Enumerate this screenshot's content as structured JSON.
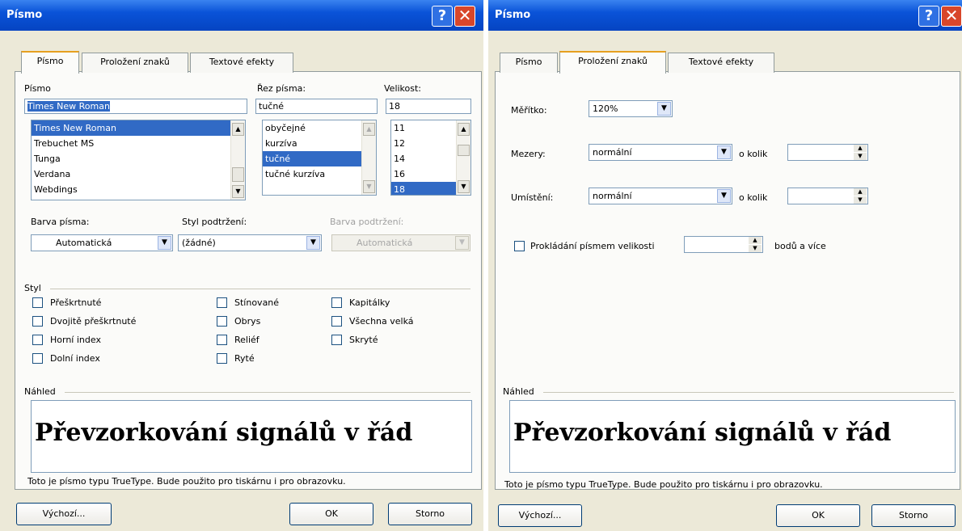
{
  "left": {
    "title": "Písmo",
    "tabs": [
      "Písmo",
      "Proložení znaků",
      "Textové efekty"
    ],
    "font_label": "Písmo",
    "style_label": "Řez písma:",
    "size_label": "Velikost:",
    "font_value": "Times New Roman",
    "style_value": "tučné",
    "size_value": "18",
    "font_list": [
      "Times New Roman",
      "Trebuchet MS",
      "Tunga",
      "Verdana",
      "Webdings"
    ],
    "style_list": [
      "obyčejné",
      "kurzíva",
      "tučné",
      "tučné kurzíva"
    ],
    "size_list": [
      "11",
      "12",
      "14",
      "16",
      "18"
    ],
    "font_color_label": "Barva písma:",
    "underline_style_label": "Styl podtržení:",
    "underline_color_label": "Barva podtržení:",
    "font_color_value": "Automatická",
    "underline_style_value": "(žádné)",
    "underline_color_value": "Automatická",
    "effects_label": "Styl",
    "effects": {
      "strikethrough": "Přeškrtnuté",
      "double_strikethrough": "Dvojitě přeškrtnuté",
      "superscript": "Horní index",
      "subscript": "Dolní index",
      "shadow": "Stínované",
      "outline": "Obrys",
      "emboss": "Reliéf",
      "engrave": "Ryté",
      "small_caps": "Kapitálky",
      "all_caps": "Všechna velká",
      "hidden": "Skryté"
    },
    "preview_label": "Náhled",
    "preview_text": "Převzorkování signálů v řád",
    "truetype_note": "Toto je písmo typu TrueType. Bude použito pro tiskárnu i pro obrazovku.",
    "default_button": "Výchozí...",
    "ok_button": "OK",
    "cancel_button": "Storno"
  },
  "right": {
    "title": "Písmo",
    "tabs": [
      "Písmo",
      "Proložení znaků",
      "Textové efekty"
    ],
    "scale_label": "Měřítko:",
    "scale_value": "120%",
    "spacing_label": "Mezery:",
    "spacing_value": "normální",
    "by_label": "o kolik",
    "position_label": "Umístění:",
    "position_value": "normální",
    "by_label_2": "o kolik",
    "kerning_label": "Prokládání písmem velikosti",
    "kerning_suffix": "bodů a více",
    "preview_label": "Náhled",
    "preview_text": "Převzorkování signálů v řád",
    "truetype_note": "Toto je písmo typu TrueType. Bude použito pro tiskárnu i pro obrazovku.",
    "default_button": "Výchozí...",
    "ok_button": "OK",
    "cancel_button": "Storno"
  },
  "icons": {
    "help": "help-icon",
    "close": "close-icon",
    "dropdown": "chevron-down-icon"
  },
  "colors": {
    "titlebar": "#0a53d8",
    "selection": "#316ac5",
    "dialog_bg": "#ece9d8",
    "close": "#d8462a"
  }
}
